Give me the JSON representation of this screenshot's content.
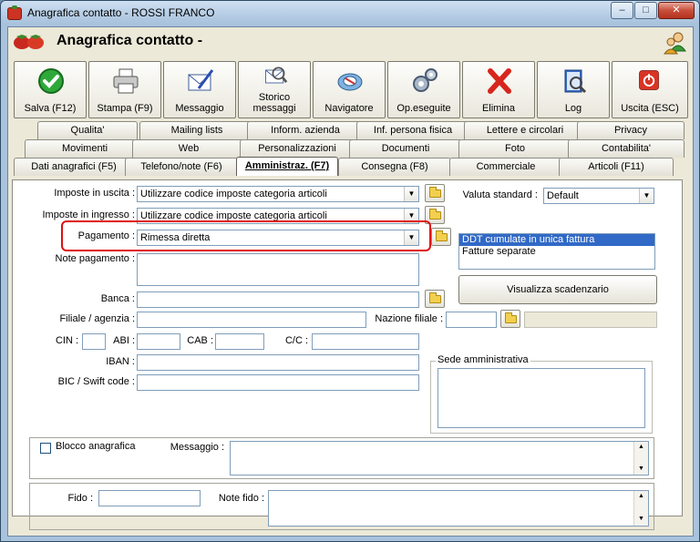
{
  "window": {
    "title": "Anagrafica contatto - ROSSI FRANCO",
    "minimize": "–",
    "maximize": "□",
    "close": "✕"
  },
  "header": {
    "title": "Anagrafica contatto -"
  },
  "toolbar": [
    {
      "label": "Salva (F12)",
      "icon": "check-icon"
    },
    {
      "label": "Stampa (F9)",
      "icon": "printer-icon"
    },
    {
      "label": "Messaggio",
      "icon": "message-icon"
    },
    {
      "label": "Storico messaggi",
      "icon": "message-history-icon"
    },
    {
      "label": "Navigatore",
      "icon": "navigator-icon"
    },
    {
      "label": "Op.eseguite",
      "icon": "gears-icon"
    },
    {
      "label": "Elimina",
      "icon": "delete-icon"
    },
    {
      "label": "Log",
      "icon": "log-icon"
    },
    {
      "label": "Uscita (ESC)",
      "icon": "exit-icon"
    }
  ],
  "tabs": {
    "row1": [
      "Qualita'",
      "Mailing lists",
      "Inform. azienda",
      "Inf. persona fisica",
      "Lettere e circolari",
      "Privacy"
    ],
    "row2": [
      "Movimenti",
      "Web",
      "Personalizzazioni",
      "Documenti",
      "Foto",
      "Contabilita'"
    ],
    "row3": [
      "Dati anagrafici (F5)",
      "Telefono/note (F6)",
      "Amministraz. (F7)",
      "Consegna (F8)",
      "Commerciale",
      "Articoli (F11)"
    ]
  },
  "form": {
    "imposte_uscita_label": "Imposte in uscita :",
    "imposte_uscita_value": "Utilizzare codice imposte categoria articoli",
    "imposte_ingresso_label": "Imposte in ingresso :",
    "imposte_ingresso_value": "Utilizzare codice imposte categoria articoli",
    "pagamento_label": "Pagamento :",
    "pagamento_value": "Rimessa diretta",
    "note_pagamento_label": "Note pagamento :",
    "banca_label": "Banca :",
    "filiale_label": "Filiale / agenzia :",
    "nazione_filiale_label": "Nazione filiale :",
    "cin_label": "CIN :",
    "abi_label": "ABI :",
    "cab_label": "CAB :",
    "cc_label": "C/C :",
    "iban_label": "IBAN :",
    "bic_label": "BIC / Swift code :",
    "valuta_label": "Valuta standard :",
    "valuta_value": "Default",
    "ddt_options": [
      "DDT cumulate in unica fattura",
      "Fatture separate"
    ],
    "visualizza_button": "Visualizza scadenzario",
    "sede_label": "Sede amministrativa",
    "blocco_label": "Blocco anagrafica",
    "messaggio_label": "Messaggio :",
    "fido_label": "Fido :",
    "note_fido_label": "Note fido :"
  }
}
